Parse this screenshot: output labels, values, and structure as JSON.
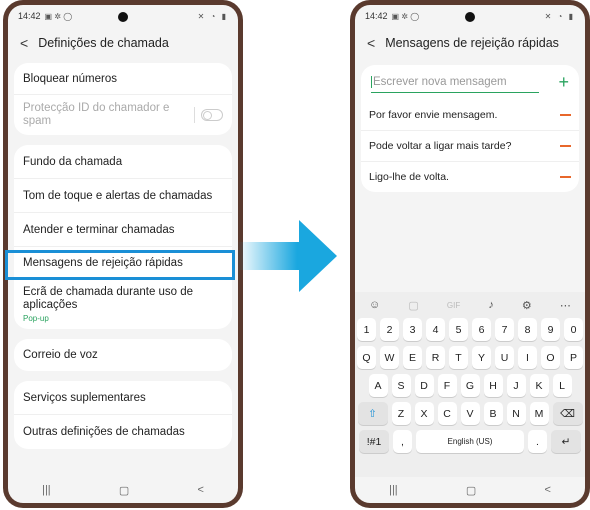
{
  "left": {
    "status_time": "14:42",
    "title": "Definições de chamada",
    "group1": [
      "Bloquear números",
      "Protecção ID do chamador e spam"
    ],
    "group2": [
      "Fundo da chamada",
      "Tom de toque e alertas de chamadas",
      "Atender e terminar chamadas",
      "Mensagens de rejeição rápidas",
      "Ecrã de chamada durante uso de aplicações"
    ],
    "popup_sub": "Pop-up",
    "voicemail": "Correio de voz",
    "group4": [
      "Serviços suplementares",
      "Outras definições de chamadas"
    ]
  },
  "right": {
    "status_time": "14:42",
    "title": "Mensagens de rejeição rápidas",
    "input_placeholder": "Escrever nova mensagem",
    "messages": [
      "Por favor envie mensagem.",
      "Pode voltar a ligar mais tarde?",
      "Ligo-lhe de volta."
    ],
    "keyboard": {
      "row1": [
        "1",
        "2",
        "3",
        "4",
        "5",
        "6",
        "7",
        "8",
        "9",
        "0"
      ],
      "row2": [
        "Q",
        "W",
        "E",
        "R",
        "T",
        "Y",
        "U",
        "I",
        "O",
        "P"
      ],
      "row3": [
        "A",
        "S",
        "D",
        "F",
        "G",
        "H",
        "J",
        "K",
        "L"
      ],
      "row4": [
        "Z",
        "X",
        "C",
        "V",
        "B",
        "N",
        "M"
      ],
      "symbols": "!#1",
      "comma": ",",
      "space": "English (US)",
      "period": "."
    }
  },
  "colors": {
    "highlight": "#1a8fd6",
    "accent": "#2aa35f",
    "remove": "#e8672b",
    "arrow": "#1aa7df"
  }
}
